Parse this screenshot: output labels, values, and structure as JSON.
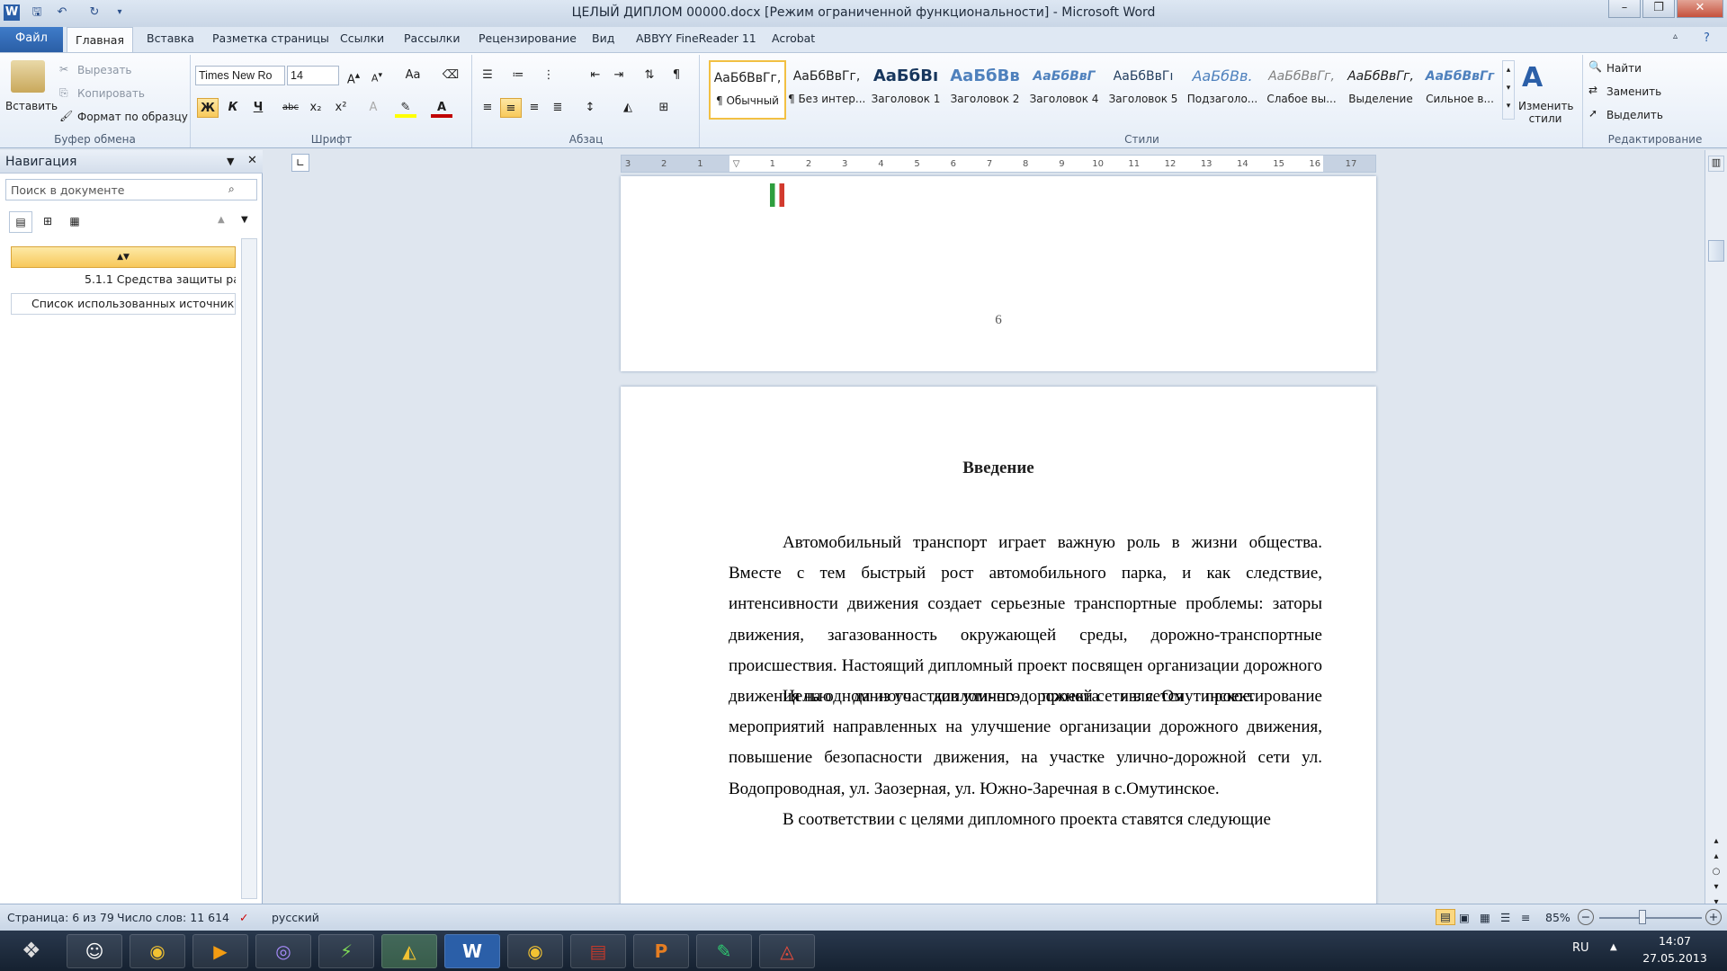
{
  "window": {
    "title": "ЦЕЛЫЙ ДИПЛОМ 00000.docx [Режим ограниченной функциональности] - Microsoft Word"
  },
  "tabs": [
    "Файл",
    "Главная",
    "Вставка",
    "Разметка страницы",
    "Ссылки",
    "Рассылки",
    "Рецензирование",
    "Вид",
    "ABBYY FineReader 11",
    "Acrobat"
  ],
  "clipboard": {
    "paste": "Вставить",
    "cut": "Вырезать",
    "copy": "Копировать",
    "format": "Формат по образцу",
    "group": "Буфер обмена"
  },
  "font": {
    "name": "Times New Ro",
    "size": "14",
    "group": "Шрифт",
    "bold": "Ж",
    "italic": "К",
    "underline": "Ч",
    "strike": "abc",
    "sub": "x₂",
    "sup": "x²",
    "case": "Aa"
  },
  "paragraph": {
    "group": "Абзац"
  },
  "styles": {
    "group": "Стили",
    "change": "Изменить стили",
    "items": [
      {
        "sample": "АаБбВвГг,",
        "name": "¶ Обычный"
      },
      {
        "sample": "АаБбВвГг,",
        "name": "¶ Без интер..."
      },
      {
        "sample": "АаБбВı",
        "name": "Заголовок 1"
      },
      {
        "sample": "АаБбВв",
        "name": "Заголовок 2"
      },
      {
        "sample": "АаБбВвГ",
        "name": "Заголовок 4"
      },
      {
        "sample": "АаБбВвГı",
        "name": "Заголовок 5"
      },
      {
        "sample": "АаБбВв.",
        "name": "Подзаголо..."
      },
      {
        "sample": "АаБбВвГг,",
        "name": "Слабое вы..."
      },
      {
        "sample": "АаБбВвГг,",
        "name": "Выделение"
      },
      {
        "sample": "АаБбВвГг",
        "name": "Сильное в..."
      }
    ]
  },
  "editing": {
    "group": "Редактирование",
    "find": "Найти",
    "replace": "Заменить",
    "select": "Выделить"
  },
  "nav": {
    "title": "Навигация",
    "search_placeholder": "Поиск в документе",
    "items": [
      "5.1.1 Средства защиты ра...",
      "Список использованных источников"
    ]
  },
  "ruler": {
    "ticks": [
      "3",
      "2",
      "1",
      "",
      "1",
      "2",
      "3",
      "4",
      "5",
      "6",
      "7",
      "8",
      "9",
      "10",
      "11",
      "12",
      "13",
      "14",
      "15",
      "16",
      "17"
    ]
  },
  "document": {
    "page_number": "6",
    "heading": "Введение",
    "paragraphs": [
      "Автомобильный транспорт играет важную роль в жизни общества. Вместе с тем быстрый рост автомобильного парка, и как следствие, интенсивности движения создает серьезные транспортные проблемы: заторы движения, загазованность окружающей среды, дорожно-транспортные происшествия. Настоящий дипломный проект посвящен организации дорожного движения на одном из участков улично-дорожной сети в с. Омутинское.",
      "Целью данного дипломного проекта является проектирование мероприятий направленных на улучшение организации дорожного движения, повышение безопасности движения, на участке улично-дорожной сети ул. Водопроводная, ул. Заозерная, ул. Южно-Заречная в с.Омутинское.",
      "В соответствии с целями дипломного проекта ставятся следующие"
    ]
  },
  "status": {
    "page": "Страница: 6 из 79",
    "words": "Число слов: 11 614",
    "lang": "русский",
    "zoom": "85%",
    "zoom_level": 0.85
  },
  "tray": {
    "lang": "RU",
    "time": "14:07",
    "date": "27.05.2013"
  }
}
